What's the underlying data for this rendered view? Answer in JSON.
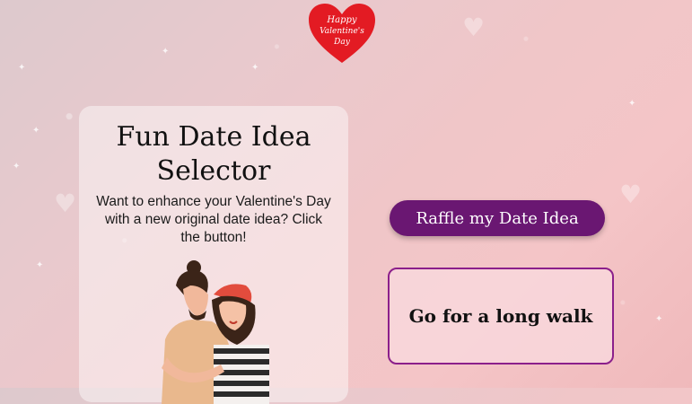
{
  "logo": {
    "line1": "Happy",
    "line2": "Valentine's",
    "line3": "Day"
  },
  "card": {
    "title": "Fun Date Idea Selector",
    "subtitle": "Want to enhance your Valentine's Day with a new original date idea? Click the button!"
  },
  "actions": {
    "raffle_label": "Raffle my Date Idea"
  },
  "result": {
    "text": "Go for a long walk"
  },
  "colors": {
    "accent": "#6a1772",
    "border": "#8b1f8b",
    "heart": "#e31b23"
  }
}
